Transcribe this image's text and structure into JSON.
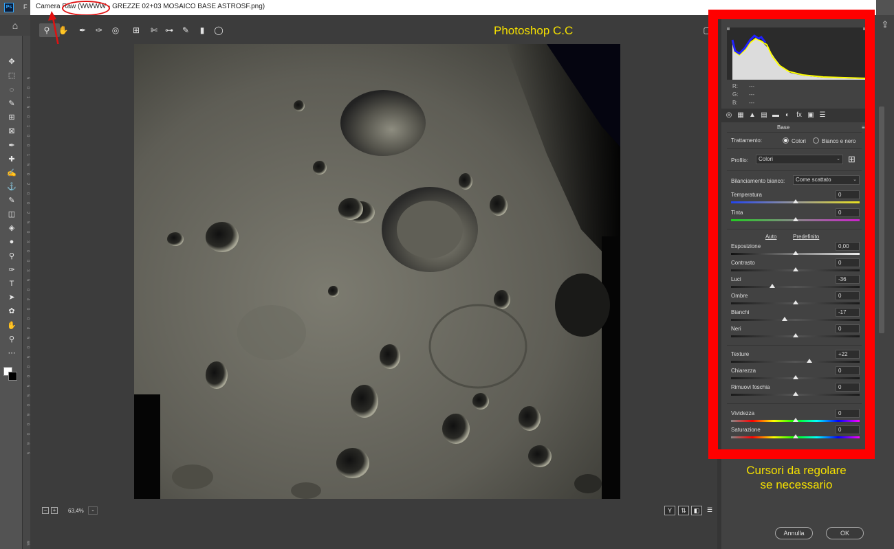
{
  "app": {
    "ps_logo": "Ps",
    "menu_first": "F",
    "window_title": "Camera Raw (WWWW - GREZZE 02+03 MOSAICO BASE ASTROSF.png)"
  },
  "watermark": "Photoshop C.C",
  "annotation": {
    "line1": "Cursori da regolare",
    "line2": "se necessario"
  },
  "ps_toolbar": {
    "icons": [
      "move-icon",
      "marquee-icon",
      "lasso-icon",
      "quick-select-icon",
      "crop-icon",
      "frame-icon",
      "eyedropper-icon",
      "healing-icon",
      "brush-icon",
      "stamp-icon",
      "history-brush-icon",
      "eraser-icon",
      "gradient-icon",
      "blur-icon",
      "dodge-icon",
      "pen-icon",
      "type-icon",
      "path-select-icon",
      "shape-icon",
      "hand-icon",
      "zoom-icon",
      "more-icon"
    ],
    "glyphs": [
      "✥",
      "⬚",
      "◌",
      "✎",
      "⊞",
      "⊠",
      "✒",
      "✚",
      "✍",
      "⚓",
      "✎",
      "◫",
      "◈",
      "●",
      "⚲",
      "✑",
      "T",
      "➤",
      "✿",
      "✋",
      "⚲",
      "⋯"
    ],
    "ruler_labels": [
      "5",
      "0",
      "1",
      "5",
      "0",
      "1",
      "0",
      "0",
      "1",
      "5",
      "0",
      "2",
      "0",
      "0",
      "2",
      "5",
      "0",
      "3",
      "0",
      "0",
      "3",
      "5",
      "0",
      "4",
      "0",
      "0",
      "4",
      "5",
      "0",
      "5",
      "0",
      "0",
      "5",
      "5",
      "0",
      "6",
      "0",
      "0",
      "6",
      "5"
    ],
    "bottom_label": "66"
  },
  "cr_toolbar": {
    "tools": [
      {
        "name": "zoom-tool",
        "glyph": "⚲"
      },
      {
        "name": "hand-tool",
        "glyph": "✋"
      },
      {
        "name": "white-balance-tool",
        "glyph": "✒"
      },
      {
        "name": "color-sampler-tool",
        "glyph": "✑"
      },
      {
        "name": "targeted-adjust-tool",
        "glyph": "◎"
      },
      {
        "name": "crop-tool",
        "glyph": "⊞"
      },
      {
        "name": "spot-removal-tool",
        "glyph": "✄"
      },
      {
        "name": "red-eye-tool",
        "glyph": "⊶"
      },
      {
        "name": "adjustment-brush-tool",
        "glyph": "✎"
      },
      {
        "name": "graduated-filter-tool",
        "glyph": "▮"
      },
      {
        "name": "radial-filter-tool",
        "glyph": "◯"
      }
    ],
    "fullscreen_glyph": "▢"
  },
  "bottom_bar": {
    "zoom_out": "−",
    "zoom_in": "+",
    "zoom_value": "63,4%",
    "zoom_caret": "⌄",
    "view_buttons": [
      "Y",
      "⇅",
      "◧",
      "☰"
    ]
  },
  "histogram": {
    "r_label": "R:",
    "r_value": "---",
    "g_label": "G:",
    "g_value": "---",
    "b_label": "B:",
    "b_value": "---"
  },
  "panel_tabs": [
    "◎",
    "▦",
    "▲",
    "▤",
    "▬",
    "◐",
    "fx",
    "▣",
    "☰"
  ],
  "panel": {
    "section_title": "Base",
    "section_menu": "≡",
    "trattamento_label": "Trattamento:",
    "treatment_options": [
      "Colori",
      "Bianco e nero"
    ],
    "treatment_selected": "Colori",
    "profilo_label": "Profilo:",
    "profilo_value": "Colori",
    "profilo_browse": "⊞",
    "wb_label": "Bilanciamento bianco:",
    "wb_value": "Come scattato",
    "auto_link": "Auto",
    "predefinito_link": "Predefinito"
  },
  "sliders": [
    {
      "label": "Temperatura",
      "value": "0",
      "pos": 0.5,
      "track": "temp"
    },
    {
      "label": "Tinta",
      "value": "0",
      "pos": 0.5,
      "track": "tint"
    },
    {
      "label": "Esposizione",
      "value": "0,00",
      "pos": 0.5,
      "track": "tonal"
    },
    {
      "label": "Contrasto",
      "value": "0",
      "pos": 0.5,
      "track": "gray"
    },
    {
      "label": "Luci",
      "value": "-36",
      "pos": 0.32,
      "track": "gray"
    },
    {
      "label": "Ombre",
      "value": "0",
      "pos": 0.5,
      "track": "gray"
    },
    {
      "label": "Bianchi",
      "value": "-17",
      "pos": 0.415,
      "track": "gray"
    },
    {
      "label": "Neri",
      "value": "0",
      "pos": 0.5,
      "track": "gray"
    },
    {
      "label": "Texture",
      "value": "+22",
      "pos": 0.61,
      "track": "gray"
    },
    {
      "label": "Chiarezza",
      "value": "0",
      "pos": 0.5,
      "track": "gray"
    },
    {
      "label": "Rimuovi foschia",
      "value": "0",
      "pos": 0.5,
      "track": "gray"
    },
    {
      "label": "Vividezza",
      "value": "0",
      "pos": 0.5,
      "track": "vib"
    },
    {
      "label": "Saturazione",
      "value": "0",
      "pos": 0.5,
      "track": "vib"
    }
  ],
  "buttons": {
    "cancel": "Annulla",
    "ok": "OK"
  },
  "colors": {
    "annotation_red": "#ff0000",
    "annotation_yellow": "#f5e000",
    "panel_bg": "#424242",
    "ui_bg": "#3c3c3c"
  }
}
